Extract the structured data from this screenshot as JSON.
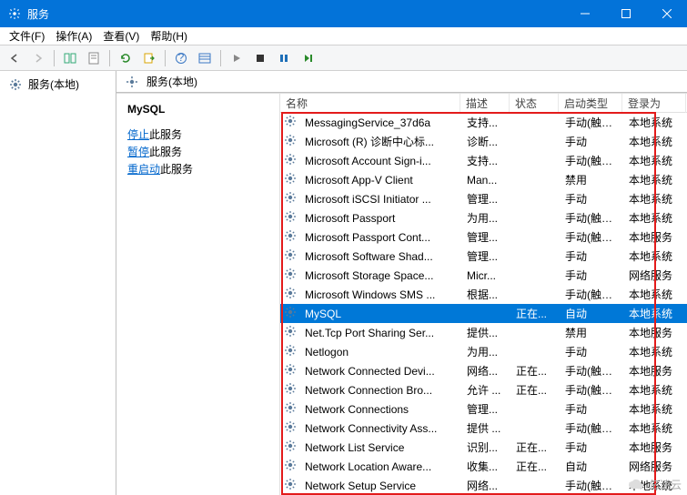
{
  "window": {
    "title": "服务"
  },
  "menu": {
    "file": "文件(F)",
    "action": "操作(A)",
    "view": "查看(V)",
    "help": "帮助(H)"
  },
  "tree": {
    "root": "服务(本地)"
  },
  "local_header": "服务(本地)",
  "detail": {
    "title": "MySQL",
    "stop_link": "停止",
    "stop_suffix": "此服务",
    "pause_link": "暂停",
    "pause_suffix": "此服务",
    "restart_link": "重启动",
    "restart_suffix": "此服务"
  },
  "columns": {
    "name": "名称",
    "desc": "描述",
    "status": "状态",
    "startup": "启动类型",
    "logon": "登录为"
  },
  "services": [
    {
      "name": "MessagingService_37d6a",
      "desc": "支持...",
      "status": "",
      "startup": "手动(触发...",
      "logon": "本地系统"
    },
    {
      "name": "Microsoft (R) 诊断中心标...",
      "desc": "诊断...",
      "status": "",
      "startup": "手动",
      "logon": "本地系统"
    },
    {
      "name": "Microsoft Account Sign-i...",
      "desc": "支持...",
      "status": "",
      "startup": "手动(触发...",
      "logon": "本地系统"
    },
    {
      "name": "Microsoft App-V Client",
      "desc": "Man...",
      "status": "",
      "startup": "禁用",
      "logon": "本地系统"
    },
    {
      "name": "Microsoft iSCSI Initiator ...",
      "desc": "管理...",
      "status": "",
      "startup": "手动",
      "logon": "本地系统"
    },
    {
      "name": "Microsoft Passport",
      "desc": "为用...",
      "status": "",
      "startup": "手动(触发...",
      "logon": "本地系统"
    },
    {
      "name": "Microsoft Passport Cont...",
      "desc": "管理...",
      "status": "",
      "startup": "手动(触发...",
      "logon": "本地服务"
    },
    {
      "name": "Microsoft Software Shad...",
      "desc": "管理...",
      "status": "",
      "startup": "手动",
      "logon": "本地系统"
    },
    {
      "name": "Microsoft Storage Space...",
      "desc": "Micr...",
      "status": "",
      "startup": "手动",
      "logon": "网络服务"
    },
    {
      "name": "Microsoft Windows SMS ...",
      "desc": "根据...",
      "status": "",
      "startup": "手动(触发...",
      "logon": "本地系统"
    },
    {
      "name": "MySQL",
      "desc": "",
      "status": "正在...",
      "startup": "自动",
      "logon": "本地系统",
      "selected": true
    },
    {
      "name": "Net.Tcp Port Sharing Ser...",
      "desc": "提供...",
      "status": "",
      "startup": "禁用",
      "logon": "本地服务"
    },
    {
      "name": "Netlogon",
      "desc": "为用...",
      "status": "",
      "startup": "手动",
      "logon": "本地系统"
    },
    {
      "name": "Network Connected Devi...",
      "desc": "网络...",
      "status": "正在...",
      "startup": "手动(触发...",
      "logon": "本地服务"
    },
    {
      "name": "Network Connection Bro...",
      "desc": "允许 ...",
      "status": "正在...",
      "startup": "手动(触发...",
      "logon": "本地系统"
    },
    {
      "name": "Network Connections",
      "desc": "管理...",
      "status": "",
      "startup": "手动",
      "logon": "本地系统"
    },
    {
      "name": "Network Connectivity Ass...",
      "desc": "提供 ...",
      "status": "",
      "startup": "手动(触发...",
      "logon": "本地系统"
    },
    {
      "name": "Network List Service",
      "desc": "识别...",
      "status": "正在...",
      "startup": "手动",
      "logon": "本地服务"
    },
    {
      "name": "Network Location Aware...",
      "desc": "收集...",
      "status": "正在...",
      "startup": "自动",
      "logon": "网络服务"
    },
    {
      "name": "Network Setup Service",
      "desc": "网络...",
      "status": "",
      "startup": "手动(触发...",
      "logon": "本地系统"
    }
  ],
  "watermark": "亿速云"
}
